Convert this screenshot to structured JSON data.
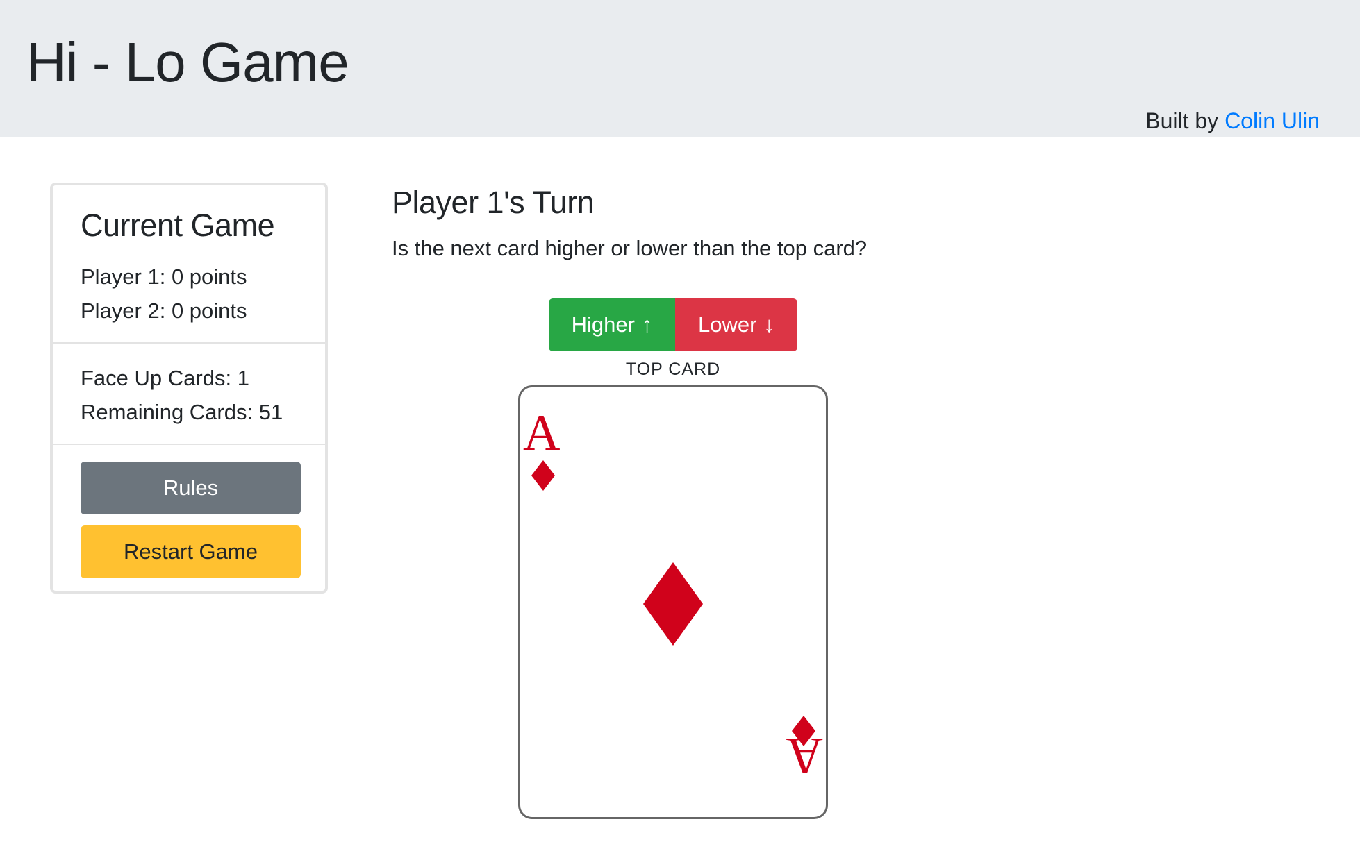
{
  "header": {
    "title": "Hi - Lo Game",
    "credit_prefix": "Built by ",
    "credit_author": "Colin Ulin"
  },
  "scoreboard": {
    "heading": "Current Game",
    "players": [
      "Player 1: 0 points",
      "Player 2: 0 points"
    ],
    "face_up": "Face Up Cards: 1",
    "remaining": "Remaining Cards: 51",
    "rules_label": "Rules",
    "restart_label": "Restart Game"
  },
  "game": {
    "turn_heading": "Player 1's Turn",
    "prompt": "Is the next card higher or lower than the top card?",
    "higher_label": "Higher",
    "higher_arrow": "↑",
    "lower_label": "Lower",
    "lower_arrow": "↓",
    "top_card_label": "TOP CARD",
    "top_card": {
      "rank": "A",
      "suit": "diamonds",
      "color": "#d0021b"
    }
  },
  "colors": {
    "higher": "#28a745",
    "lower": "#dc3545",
    "rules": "#6c757d",
    "restart": "#ffc130",
    "link": "#007bff",
    "header_bg": "#e9ecef"
  }
}
